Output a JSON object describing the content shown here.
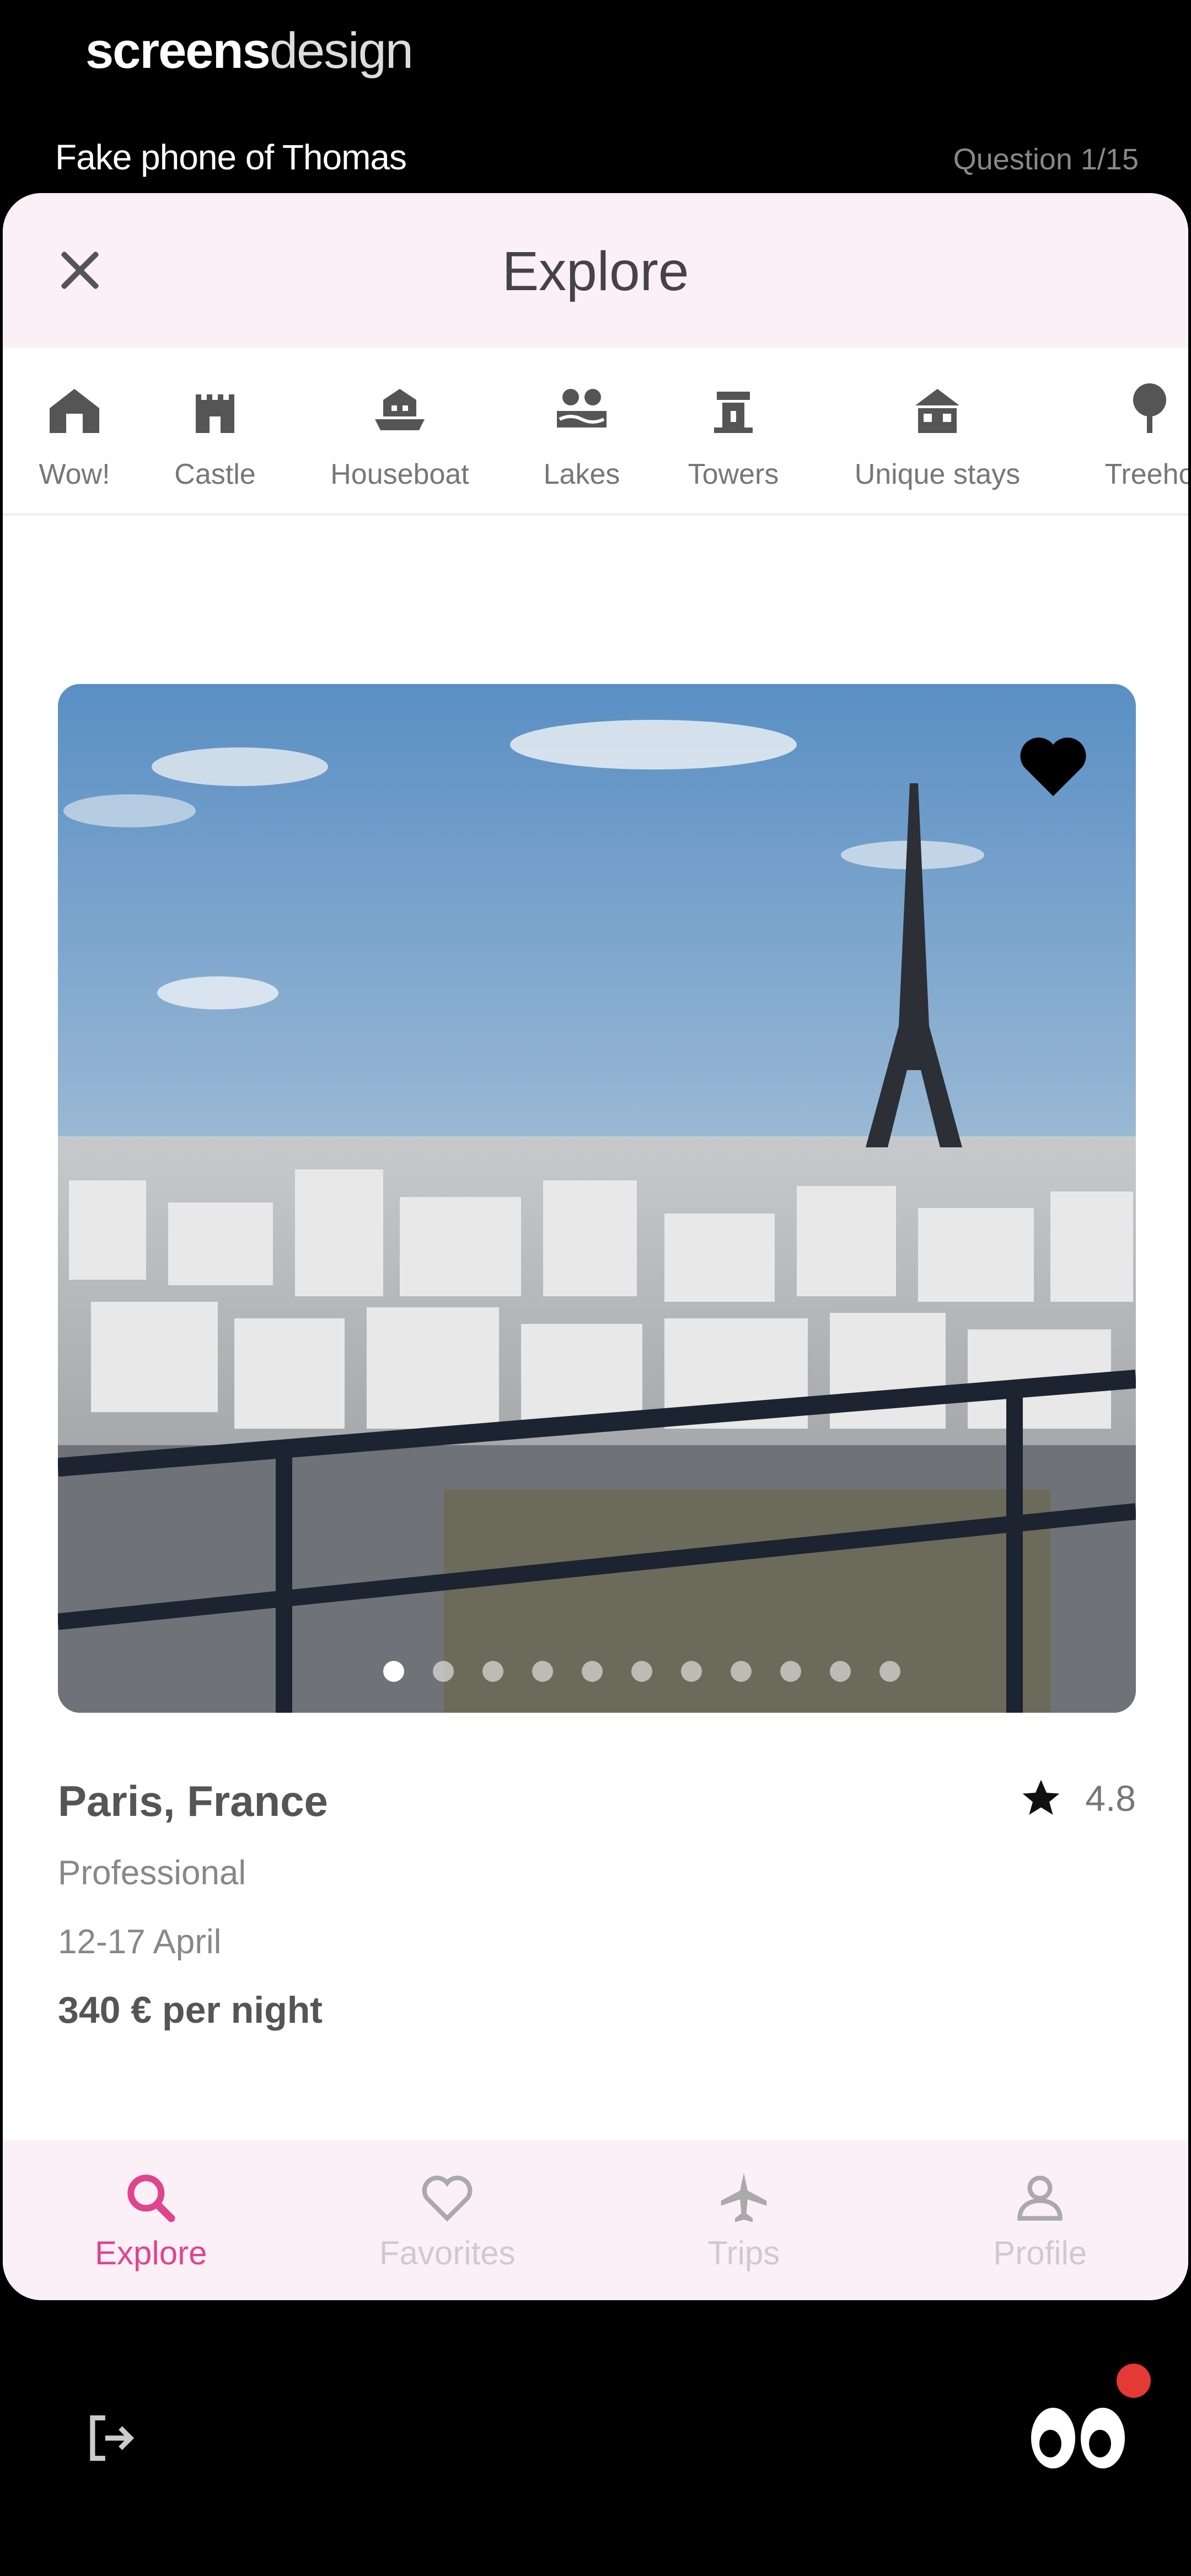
{
  "brand": {
    "bold": "screens",
    "light": "design"
  },
  "device_label": "Fake phone of Thomas",
  "question_counter": "Question 1/15",
  "header": {
    "title": "Explore"
  },
  "categories": [
    {
      "label": "Wow!",
      "icon": "home-icon"
    },
    {
      "label": "Castle",
      "icon": "castle-icon"
    },
    {
      "label": "Houseboat",
      "icon": "houseboat-icon"
    },
    {
      "label": "Lakes",
      "icon": "lakes-icon"
    },
    {
      "label": "Towers",
      "icon": "tower-icon"
    },
    {
      "label": "Unique stays",
      "icon": "unique-stays-icon"
    },
    {
      "label": "Treeho",
      "icon": "treehouse-icon"
    }
  ],
  "listing": {
    "location": "Paris, France",
    "rating": "4.8",
    "host_type": "Professional",
    "dates": "12-17 April",
    "price": "340 € per night",
    "photo_count": 11,
    "active_photo": 1
  },
  "tabs": [
    {
      "label": "Explore",
      "icon": "search-icon",
      "active": true
    },
    {
      "label": "Favorites",
      "icon": "heart-outline-icon",
      "active": false
    },
    {
      "label": "Trips",
      "icon": "airplane-icon",
      "active": false
    },
    {
      "label": "Profile",
      "icon": "profile-icon",
      "active": false
    }
  ],
  "colors": {
    "accent": "#e0448d",
    "bar_background": "#fcf0f7"
  }
}
